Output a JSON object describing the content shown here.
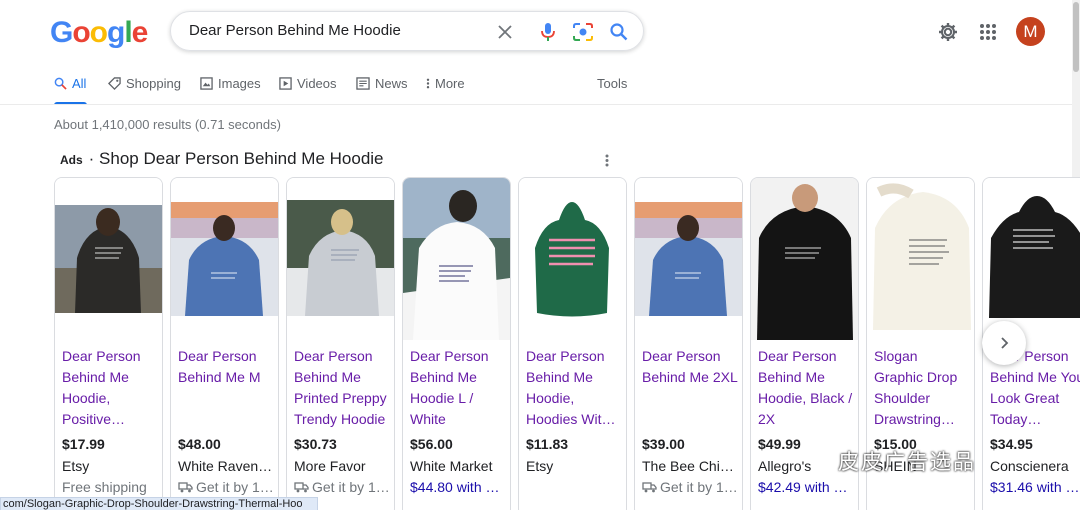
{
  "header": {
    "logo_letters": [
      "G",
      "o",
      "o",
      "g",
      "l",
      "e"
    ],
    "logo_colors": [
      "#4285f4",
      "#ea4335",
      "#fbbc05",
      "#4285f4",
      "#34a853",
      "#ea4335"
    ],
    "search_value": "Dear Person Behind Me Hoodie",
    "avatar_initial": "M"
  },
  "tabs": [
    {
      "label": "All",
      "icon": "search-icon",
      "active": true
    },
    {
      "label": "Shopping",
      "icon": "tag-icon",
      "active": false
    },
    {
      "label": "Images",
      "icon": "image-icon",
      "active": false
    },
    {
      "label": "Videos",
      "icon": "play-icon",
      "active": false
    },
    {
      "label": "News",
      "icon": "news-icon",
      "active": false
    },
    {
      "label": "More",
      "icon": "more-vertical-icon",
      "active": false
    }
  ],
  "tools_label": "Tools",
  "results_stats": "About 1,410,000 results (0.71 seconds)",
  "ads": {
    "label": "Ads",
    "title": "· Shop Dear Person Behind Me Hoodie"
  },
  "products": [
    {
      "title": "Dear Person Behind Me Hoodie, Positive…",
      "price": "$17.99",
      "merchant": "Etsy",
      "extra": "Free shipping",
      "extra_type": "plain",
      "visited": true,
      "image": "black-hoodie-beach-photo"
    },
    {
      "title": "Dear Person Behind Me M",
      "price": "$48.00",
      "merchant": "White Raven …",
      "extra": "Get it by 1…",
      "extra_type": "delivery",
      "visited": true,
      "image": "blue-hoodie-sunset-photo"
    },
    {
      "title": "Dear Person Behind Me Printed Preppy Trendy Hoodie",
      "price": "$30.73",
      "merchant": "More Favor",
      "extra": "Get it by 1…",
      "extra_type": "delivery",
      "visited": true,
      "image": "grey-hoodie-snow-photo"
    },
    {
      "title": "Dear Person Behind Me Hoodie L / White",
      "price": "$56.00",
      "merchant": "White Market",
      "extra": "$44.80 with …",
      "extra_type": "sale",
      "visited": true,
      "image": "white-hoodie-mountain-photo"
    },
    {
      "title": "Dear Person Behind Me Hoodie, Hoodies Wit…",
      "price": "$11.83",
      "merchant": "Etsy",
      "extra": "",
      "extra_type": "plain",
      "visited": true,
      "image": "green-hoodie-product-photo"
    },
    {
      "title": "Dear Person Behind Me 2XL",
      "price": "$39.00",
      "merchant": "The Bee Chic…",
      "extra": "Get it by 1…",
      "extra_type": "delivery",
      "visited": true,
      "image": "blue-hoodie-sunset-photo"
    },
    {
      "title": "Dear Person Behind Me Hoodie, Black / 2X",
      "price": "$49.99",
      "merchant": "Allegro's",
      "extra": "$42.49 with …",
      "extra_type": "sale",
      "visited": true,
      "image": "black-hoodie-man-photo"
    },
    {
      "title": "Slogan Graphic Drop Shoulder Drawstring…",
      "price": "$15.00",
      "merchant": "SHEIN",
      "extra": "",
      "extra_type": "plain",
      "visited": true,
      "image": "cream-hoodie-photo"
    },
    {
      "title": "Dear Person Behind Me You Look Great Today…",
      "price": "$34.95",
      "merchant": "Conscienera",
      "extra": "$31.46 with …",
      "extra_type": "sale",
      "visited": true,
      "image": "black-hoodie-product-photo"
    }
  ],
  "status_url": "com/Slogan-Graphic-Drop-Shoulder-Drawstring-Thermal-Hoo",
  "watermark": "皮皮广告选品"
}
